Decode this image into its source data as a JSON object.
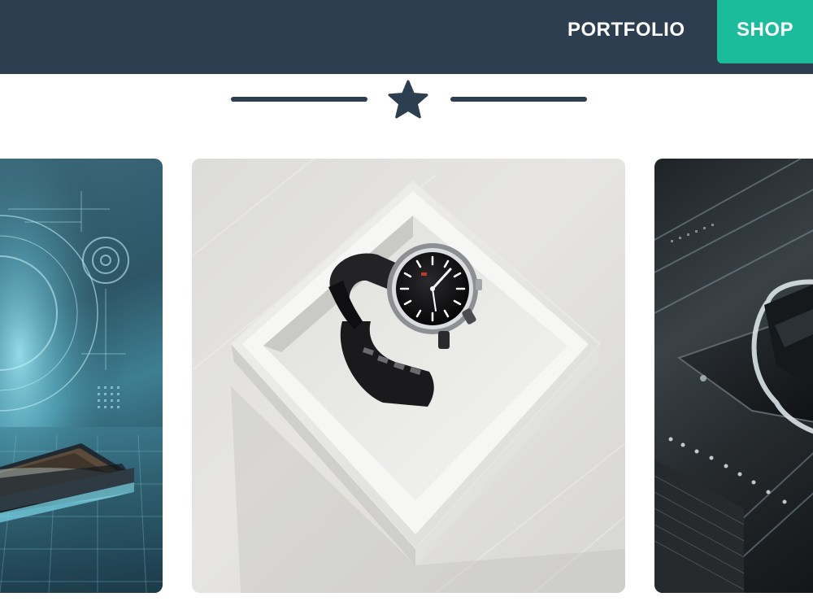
{
  "nav": {
    "items": [
      {
        "label": "PORTFOLIO"
      },
      {
        "label": "SHOP"
      }
    ],
    "colors": {
      "bar": "#2c3e50",
      "active": "#1abc9c",
      "text": "#ffffff"
    }
  },
  "divider": {
    "icon": "star-icon",
    "color": "#2c3e50"
  },
  "gallery": {
    "items": [
      {
        "subject": "tech-laptop-image"
      },
      {
        "subject": "wristwatch-in-box-image"
      },
      {
        "subject": "tech-device-image"
      }
    ]
  }
}
